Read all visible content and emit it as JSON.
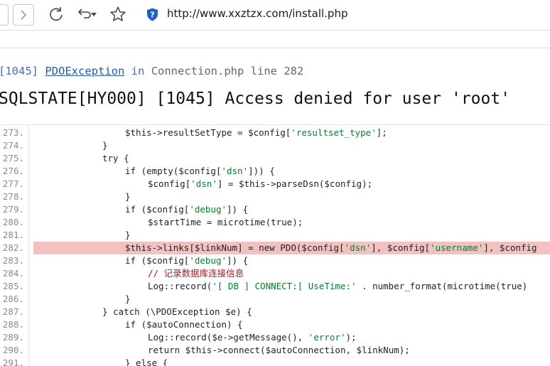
{
  "browser": {
    "url": "http://www.xxztzx.com/install.php",
    "icons": [
      "back-icon",
      "forward-icon",
      "refresh-icon",
      "undo-icon",
      "dropdown-arrow-icon",
      "favorite-star-icon",
      "shield-icon"
    ]
  },
  "exception": {
    "code": "[1045]",
    "class": "PDOException",
    "in": "in",
    "file": "Connection.php line 282",
    "message": "SQLSTATE[HY000] [1045] Access denied for user 'root'"
  },
  "source": {
    "highlight_line": "282.",
    "lines": [
      {
        "num": "273.",
        "indent": 4,
        "tokens": [
          [
            "v",
            "$this"
          ],
          [
            "o",
            "->resultSetType = "
          ],
          [
            "v",
            "$config"
          ],
          [
            "o",
            "["
          ],
          [
            "s",
            "'resultset_type'"
          ],
          [
            "o",
            "];"
          ]
        ]
      },
      {
        "num": "274.",
        "indent": 3,
        "tokens": [
          [
            "o",
            "}"
          ]
        ]
      },
      {
        "num": "275.",
        "indent": 3,
        "tokens": [
          [
            "o",
            "try {"
          ]
        ]
      },
      {
        "num": "276.",
        "indent": 4,
        "tokens": [
          [
            "o",
            "if (empty("
          ],
          [
            "v",
            "$config"
          ],
          [
            "o",
            "["
          ],
          [
            "s",
            "'dsn'"
          ],
          [
            "o",
            "])) {"
          ]
        ]
      },
      {
        "num": "277.",
        "indent": 5,
        "tokens": [
          [
            "v",
            "$config"
          ],
          [
            "o",
            "["
          ],
          [
            "s",
            "'dsn'"
          ],
          [
            "o",
            "] = "
          ],
          [
            "v",
            "$this"
          ],
          [
            "o",
            "->parseDsn("
          ],
          [
            "v",
            "$config"
          ],
          [
            "o",
            ");"
          ]
        ]
      },
      {
        "num": "278.",
        "indent": 4,
        "tokens": [
          [
            "o",
            "}"
          ]
        ]
      },
      {
        "num": "279.",
        "indent": 4,
        "tokens": [
          [
            "o",
            "if ("
          ],
          [
            "v",
            "$config"
          ],
          [
            "o",
            "["
          ],
          [
            "s",
            "'debug'"
          ],
          [
            "o",
            "]) {"
          ]
        ]
      },
      {
        "num": "280.",
        "indent": 5,
        "tokens": [
          [
            "v",
            "$startTime"
          ],
          [
            "o",
            " = microtime(true);"
          ]
        ]
      },
      {
        "num": "281.",
        "indent": 4,
        "tokens": [
          [
            "o",
            "}"
          ]
        ]
      },
      {
        "num": "282.",
        "indent": 4,
        "tokens": [
          [
            "v",
            "$this"
          ],
          [
            "o",
            "->links["
          ],
          [
            "v",
            "$linkNum"
          ],
          [
            "o",
            "] = new PDO("
          ],
          [
            "v",
            "$config"
          ],
          [
            "o",
            "["
          ],
          [
            "s",
            "'dsn'"
          ],
          [
            "o",
            "], "
          ],
          [
            "v",
            "$config"
          ],
          [
            "o",
            "["
          ],
          [
            "s",
            "'username'"
          ],
          [
            "o",
            "], "
          ],
          [
            "v",
            "$config"
          ]
        ]
      },
      {
        "num": "283.",
        "indent": 4,
        "tokens": [
          [
            "o",
            "if ("
          ],
          [
            "v",
            "$config"
          ],
          [
            "o",
            "["
          ],
          [
            "s",
            "'debug'"
          ],
          [
            "o",
            "]) {"
          ]
        ]
      },
      {
        "num": "284.",
        "indent": 5,
        "tokens": [
          [
            "c",
            "// 记录数据库连接信息"
          ]
        ]
      },
      {
        "num": "285.",
        "indent": 5,
        "tokens": [
          [
            "o",
            "Log::record("
          ],
          [
            "s",
            "'[ DB ] CONNECT:[ UseTime:'"
          ],
          [
            "o",
            " . number_format(microtime(true)"
          ]
        ]
      },
      {
        "num": "286.",
        "indent": 4,
        "tokens": [
          [
            "o",
            "}"
          ]
        ]
      },
      {
        "num": "287.",
        "indent": 3,
        "tokens": [
          [
            "o",
            "} catch (\\PDOException "
          ],
          [
            "v",
            "$e"
          ],
          [
            "o",
            ") {"
          ]
        ]
      },
      {
        "num": "288.",
        "indent": 4,
        "tokens": [
          [
            "o",
            "if ("
          ],
          [
            "v",
            "$autoConnection"
          ],
          [
            "o",
            ") {"
          ]
        ]
      },
      {
        "num": "289.",
        "indent": 5,
        "tokens": [
          [
            "o",
            "Log::record("
          ],
          [
            "v",
            "$e"
          ],
          [
            "o",
            "->getMessage(), "
          ],
          [
            "s",
            "'error'"
          ],
          [
            "o",
            ");"
          ]
        ]
      },
      {
        "num": "290.",
        "indent": 5,
        "tokens": [
          [
            "o",
            "return "
          ],
          [
            "v",
            "$this"
          ],
          [
            "o",
            "->connect("
          ],
          [
            "v",
            "$autoConnection"
          ],
          [
            "o",
            ", "
          ],
          [
            "v",
            "$linkNum"
          ],
          [
            "o",
            ");"
          ]
        ]
      },
      {
        "num": "291.",
        "indent": 4,
        "tokens": [
          [
            "o",
            "} else {"
          ]
        ]
      }
    ]
  }
}
